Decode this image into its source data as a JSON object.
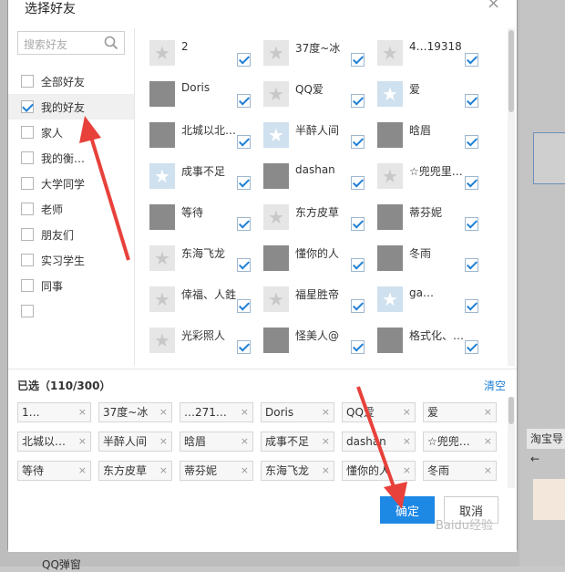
{
  "dialog": {
    "title": "选择好友",
    "close": "×"
  },
  "search": {
    "placeholder": "搜索好友"
  },
  "groups": [
    "全部好友",
    "我的好友",
    "家人",
    "我的衡…",
    "大学同学",
    "老师",
    "朋友们",
    "实习学生",
    "同事",
    ""
  ],
  "active_group": "我的好友",
  "friends": [
    [
      "2",
      "37度~冰",
      "4…19318"
    ],
    [
      "Doris",
      "QQ爱",
      "爱"
    ],
    [
      "北城以北…",
      "半醉人间",
      "晗眉"
    ],
    [
      "成事不足",
      "dashan",
      "☆兜兜里…"
    ],
    [
      "等待",
      "东方皮草",
      "蒂芬妮"
    ],
    [
      "东海飞龙",
      "懂你的人",
      "冬雨"
    ],
    [
      "倖福、人鉎",
      "福星胜帝",
      "ga…"
    ],
    [
      "光彩照人",
      "怪美人@",
      "格式化、…"
    ]
  ],
  "selected": {
    "title": "已选（110/300）",
    "clear": "清空",
    "tags": [
      [
        "1…",
        "37度~冰",
        "…271…",
        "Doris",
        "QQ爱",
        "爱"
      ],
      [
        "北城以…",
        "半醉人间",
        "晗眉",
        "成事不足",
        "dashan",
        "☆兜兜…"
      ],
      [
        "等待",
        "东方皮草",
        "蒂芬妮",
        "东海飞龙",
        "懂你的人",
        "冬雨"
      ]
    ]
  },
  "buttons": {
    "ok": "确定",
    "cancel": "取消"
  },
  "background": {
    "taobao": "淘宝导←",
    "qq": "QQ弹窗"
  },
  "watermark": "Baidu经验",
  "colors": {
    "accent": "#1e88e5",
    "arrow": "#e8413b"
  }
}
